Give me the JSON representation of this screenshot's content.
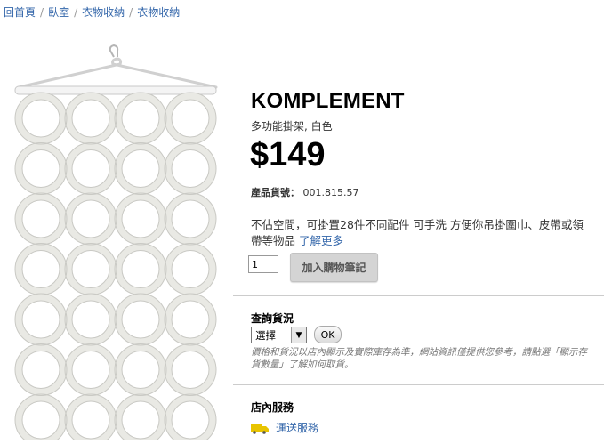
{
  "breadcrumb": [
    "回首頁",
    "臥室",
    "衣物收納",
    "衣物收納"
  ],
  "product": {
    "name": "KOMPLEMENT",
    "subtitle": "多功能掛架, 白色",
    "price": "$149",
    "article_label": "產品貨號：",
    "article_number": "001.815.57",
    "description": "不佔空間，可掛置28件不同配件 可手洗 方便你吊掛圍巾、皮帶或領帶等物品",
    "learn_more": "了解更多"
  },
  "purchase": {
    "quantity": "1",
    "add_button": "加入購物筆記"
  },
  "stock": {
    "title": "查詢貨況",
    "select_value": "選擇",
    "ok_button": "OK",
    "note": "價格和貨況以店內顯示及實際庫存為準，網站資訊僅提供您參考，請點選「顯示存貨數量」了解如何取貨。"
  },
  "services": {
    "title": "店內服務",
    "items": [
      {
        "label": "運送服務",
        "icon": "truck-icon"
      }
    ]
  },
  "colors": {
    "link": "#3366aa",
    "truck": "#e8c400"
  }
}
